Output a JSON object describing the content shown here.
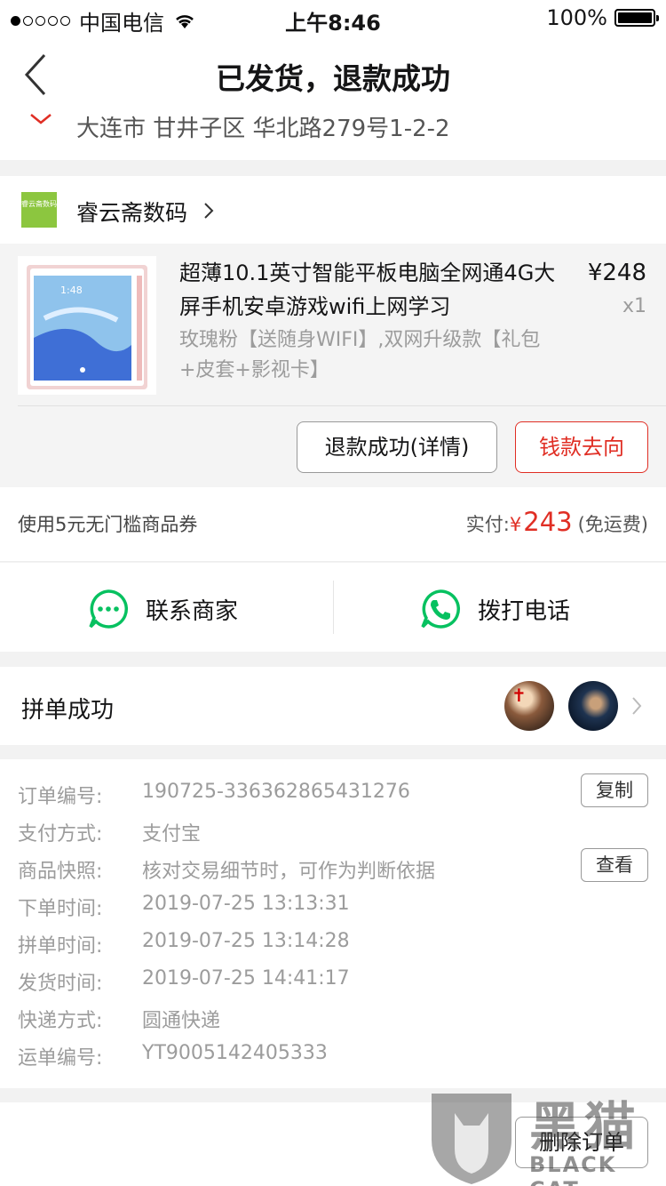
{
  "status_bar": {
    "carrier": "中国电信",
    "time": "上午8:46",
    "battery": "100%"
  },
  "nav": {
    "title": "已发货，退款成功",
    "address": "大连市 甘井子区 华北路279号1-2-2"
  },
  "shop": {
    "name": "睿云斋数码",
    "logo_text": "睿云斋数码"
  },
  "product": {
    "title": "超薄10.1英寸智能平板电脑全网通4G大屏手机安卓游戏wifi上网学习",
    "price": "¥248",
    "qty": "x1",
    "spec": "玫瑰粉【送随身WIFI】,双网升级款【礼包+皮套+影视卡】",
    "screen_time": "1:48",
    "btn_refund": "退款成功(详情)",
    "btn_money": "钱款去向"
  },
  "payment": {
    "coupon": "使用5元无门槛商品券",
    "paid_label": "实付:",
    "currency": "¥",
    "paid_amount": "243",
    "shipping_note": "(免运费)"
  },
  "contact": {
    "merchant_label": "联系商家",
    "call_label": "拨打电话"
  },
  "group": {
    "title": "拼单成功"
  },
  "order": {
    "rows": [
      {
        "key": "订单编号:",
        "value": "190725-336362865431276"
      },
      {
        "key": "支付方式:",
        "value": "支付宝"
      },
      {
        "key": "商品快照:",
        "value": "核对交易细节时，可作为判断依据"
      },
      {
        "key": "下单时间:",
        "value": "2019-07-25 13:13:31"
      },
      {
        "key": "拼单时间:",
        "value": "2019-07-25 13:14:28"
      },
      {
        "key": "发货时间:",
        "value": "2019-07-25 14:41:17"
      },
      {
        "key": "快递方式:",
        "value": "圆通快递"
      },
      {
        "key": "运单编号:",
        "value": "YT9005142405333"
      }
    ],
    "copy_label": "复制",
    "view_label": "查看"
  },
  "footer": {
    "delete_label": "删除订单"
  },
  "watermark": {
    "cn": "黑猫",
    "en": "BLACK CAT"
  },
  "colors": {
    "accent_red": "#e02e24",
    "wechat_green": "#07c160",
    "shop_logo_green": "#8cc63f"
  }
}
